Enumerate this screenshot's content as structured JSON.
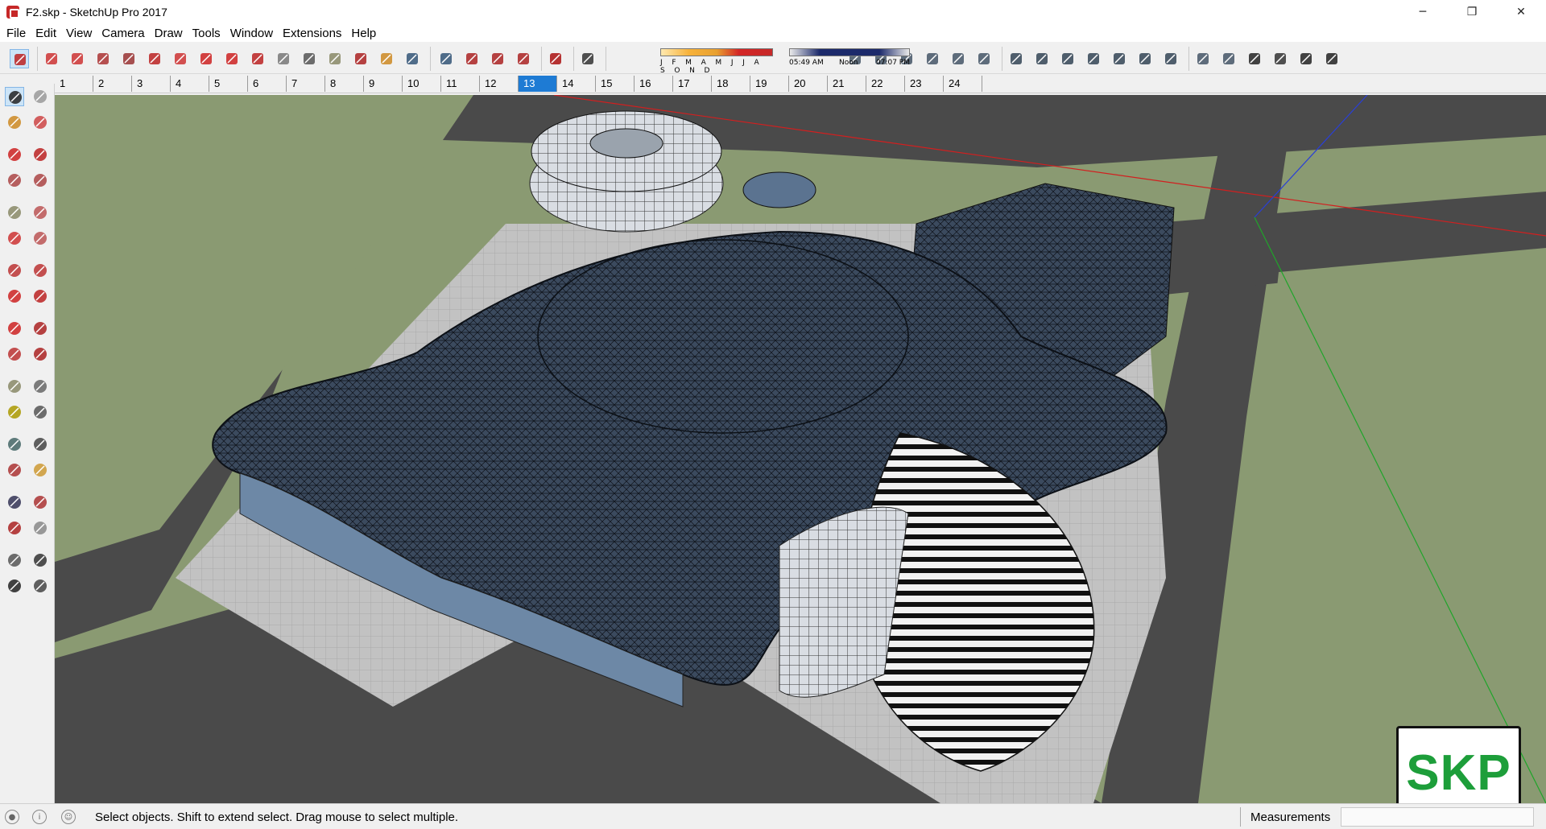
{
  "window": {
    "title": "F2.skp - SketchUp Pro 2017",
    "minimize_glyph": "─",
    "maximize_glyph": "❐",
    "close_glyph": "✕"
  },
  "menu": {
    "items": [
      "File",
      "Edit",
      "View",
      "Camera",
      "Draw",
      "Tools",
      "Window",
      "Extensions",
      "Help"
    ]
  },
  "toolbar": {
    "icons": [
      "select-icon",
      "eraser-icon",
      "pencil-icon",
      "arc-icon",
      "rectangle-icon",
      "push-pull-icon",
      "follow-me-icon",
      "move-icon",
      "rotate-icon",
      "scale-icon",
      "tape-measure-icon",
      "text-icon",
      "paint-bucket-icon",
      "orbit-icon",
      "pan-icon",
      "zoom-icon",
      "zoom-extents-icon",
      "warehouse-icon",
      "extension-warehouse-icon",
      "layout-icon",
      "ruby-icon",
      "shadow-toggle-icon",
      "iso-view-icon",
      "top-view-icon",
      "front-view-icon",
      "right-view-icon",
      "back-view-icon",
      "left-view-icon",
      "xray-icon",
      "back-edges-icon",
      "wireframe-icon",
      "hidden-line-icon",
      "shaded-icon",
      "shaded-textures-icon",
      "monochrome-icon",
      "warehouse-model-icon",
      "section-plane-icon",
      "house-icon",
      "components-icon",
      "home-icon",
      "box-icon"
    ],
    "selected": "select-icon"
  },
  "shadows": {
    "months": "J F M A M J J A S O N D",
    "time_start": "05:49 AM",
    "time_noon": "Noon",
    "time_end": "07:07 PM"
  },
  "scenes": {
    "tabs": [
      "1",
      "2",
      "3",
      "4",
      "5",
      "6",
      "7",
      "8",
      "9",
      "10",
      "11",
      "12",
      "13",
      "14",
      "15",
      "16",
      "17",
      "18",
      "19",
      "20",
      "21",
      "22",
      "23",
      "24"
    ],
    "active": "13"
  },
  "left_tools": [
    "select-icon",
    "component-icon",
    "paint-bucket-icon",
    "eraser-icon",
    "line-icon",
    "freehand-icon",
    "rectangle-icon",
    "rotated-rectangle-icon",
    "circle-icon",
    "polygon-icon",
    "arc-icon",
    "pie-icon",
    "two-point-arc-icon",
    "three-point-arc-icon",
    "move-icon",
    "push-pull-icon",
    "rotate-icon",
    "follow-me-icon",
    "scale-icon",
    "offset-icon",
    "tape-measure-icon",
    "dimension-icon",
    "protractor-icon",
    "text-icon",
    "axes-icon",
    "3d-text-icon",
    "orbit-icon",
    "pan-icon",
    "zoom-icon",
    "zoom-window-icon",
    "zoom-extents-icon",
    "previous-view-icon",
    "position-camera-icon",
    "look-around-icon",
    "walk-icon",
    "section-plane-icon"
  ],
  "logo": {
    "text": "SKP"
  },
  "status": {
    "text": "Select objects. Shift to extend select. Drag mouse to select multiple.",
    "measurements_label": "Measurements",
    "measurements_value": ""
  },
  "colors": {
    "ground": "#8a9a72",
    "road": "#4b4b4b",
    "plaza": "#c4c4c4",
    "roof_mesh": "#2e3440",
    "accent_active": "#1e7bd4",
    "logo_green": "#1d9e3a"
  }
}
